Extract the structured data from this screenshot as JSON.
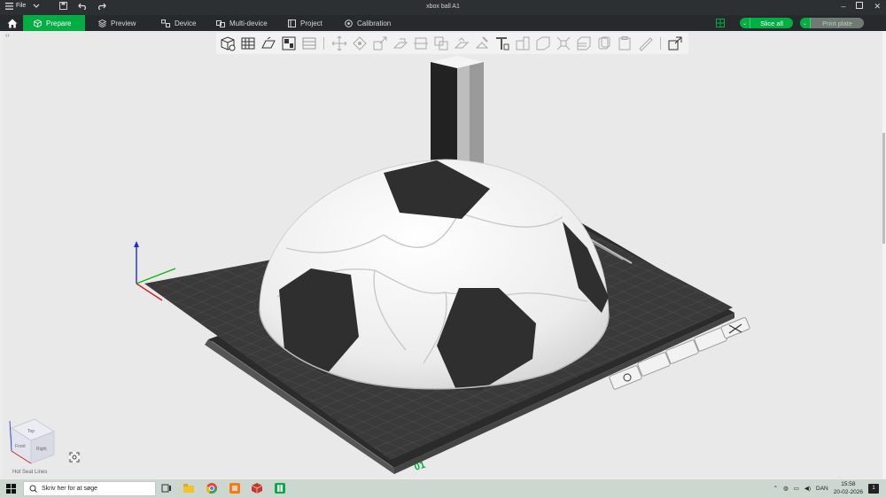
{
  "window": {
    "title": "xbox ball A1",
    "file_menu_label": "File"
  },
  "nav": {
    "tabs": [
      {
        "label": "Prepare",
        "icon": "cube-icon",
        "active": true
      },
      {
        "label": "Preview",
        "icon": "layers-icon",
        "active": false
      },
      {
        "label": "Device",
        "icon": "device-icon",
        "active": false
      },
      {
        "label": "Multi-device",
        "icon": "multi-device-icon",
        "active": false
      },
      {
        "label": "Project",
        "icon": "project-icon",
        "active": false
      },
      {
        "label": "Calibration",
        "icon": "calibration-icon",
        "active": false
      }
    ],
    "slice_all_label": "Slice all",
    "print_plate_label": "Print plate"
  },
  "viewport": {
    "plate_label": "01",
    "hidden_label": "Hot Seat Lines",
    "navcube": {
      "top": "Top",
      "front": "Front",
      "right": "Right"
    }
  },
  "colors": {
    "accent": "#00ae42",
    "titlebar": "#2d3033",
    "navbar": "#262a2d",
    "plate": "#3b3b3b",
    "taskbar": "#ccd7d0"
  },
  "taskbar": {
    "search_placeholder": "Skriv her for at søge",
    "language": "DAN",
    "time": "15:58",
    "date": "20-02-2026",
    "notification_count": "1"
  }
}
